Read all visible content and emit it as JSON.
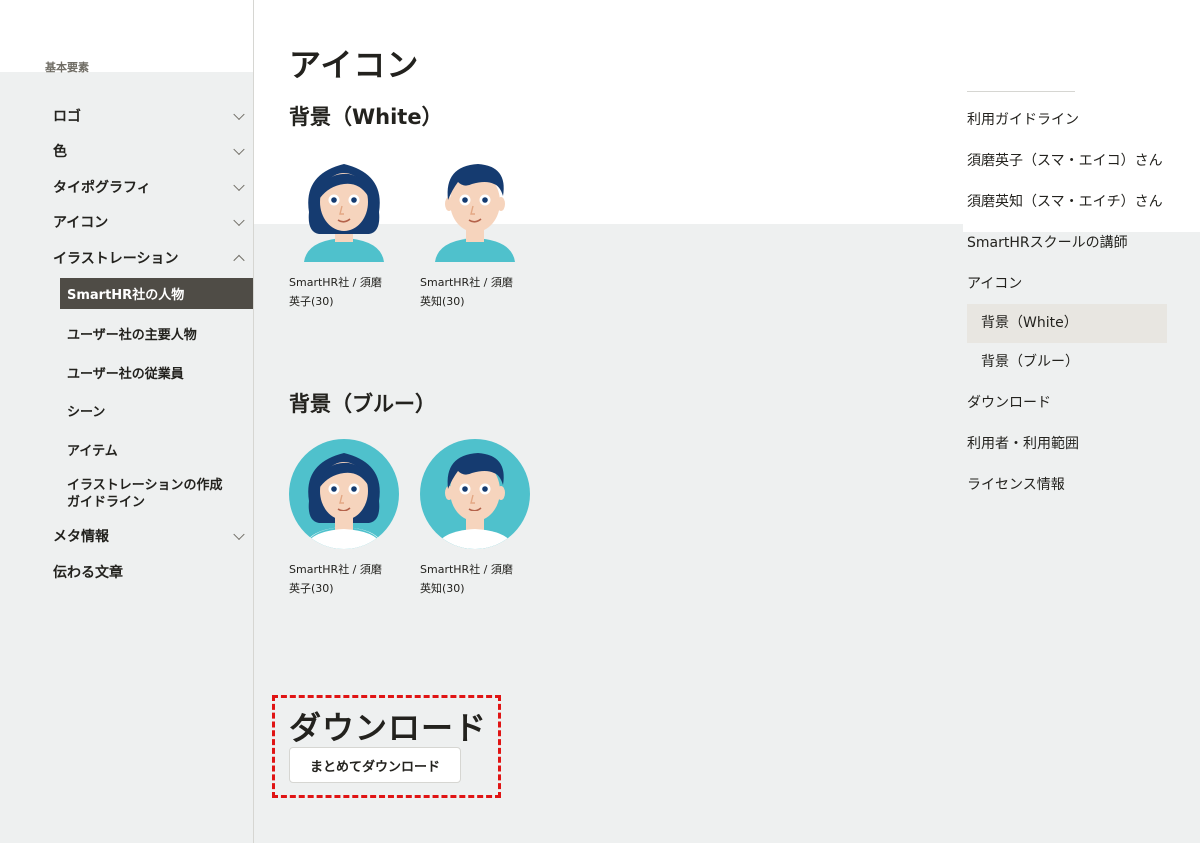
{
  "sidebar": {
    "section_label": "基本要素",
    "items": [
      {
        "label": "ロゴ"
      },
      {
        "label": "色"
      },
      {
        "label": "タイポグラフィ"
      },
      {
        "label": "アイコン"
      },
      {
        "label": "イラストレーション"
      }
    ],
    "sub_items": [
      {
        "label": "SmartHR社の人物"
      },
      {
        "label": "ユーザー社の主要人物"
      },
      {
        "label": "ユーザー社の従業員"
      },
      {
        "label": "シーン"
      },
      {
        "label": "アイテム"
      },
      {
        "label": "イラストレーションの作成ガイドライン"
      }
    ],
    "after_items": [
      {
        "label": "メタ情報"
      },
      {
        "label": "伝わる文章"
      }
    ]
  },
  "main": {
    "title": "アイコン",
    "section_white": {
      "heading": "背景（White）",
      "cards": [
        {
          "caption": "SmartHR社 / 須磨英子(30)"
        },
        {
          "caption": "SmartHR社 / 須磨英知(30)"
        }
      ]
    },
    "section_blue": {
      "heading": "背景（ブルー）",
      "cards": [
        {
          "caption": "SmartHR社 / 須磨英子(30)"
        },
        {
          "caption": "SmartHR社 / 須磨英知(30)"
        }
      ]
    },
    "download": {
      "heading": "ダウンロード",
      "button_label": "まとめてダウンロード"
    }
  },
  "toc": {
    "items": [
      {
        "label": "利用ガイドライン"
      },
      {
        "label": "須磨英子（スマ・エイコ）さん"
      },
      {
        "label": "須磨英知（スマ・エイチ）さん"
      },
      {
        "label": "SmartHRスクールの講師"
      },
      {
        "label": "アイコン"
      },
      {
        "label": "背景（White）"
      },
      {
        "label": "背景（ブルー）"
      },
      {
        "label": "ダウンロード"
      },
      {
        "label": "利用者・利用範囲"
      },
      {
        "label": "ライセンス情報"
      }
    ]
  },
  "colors": {
    "hair": "#153b70",
    "skin": "#f6d4bd",
    "shirt": "#4fc1cc",
    "blue_bg": "#4fc1cc",
    "accent_active": "#4f4c46",
    "highlight_box": "#e01414"
  }
}
